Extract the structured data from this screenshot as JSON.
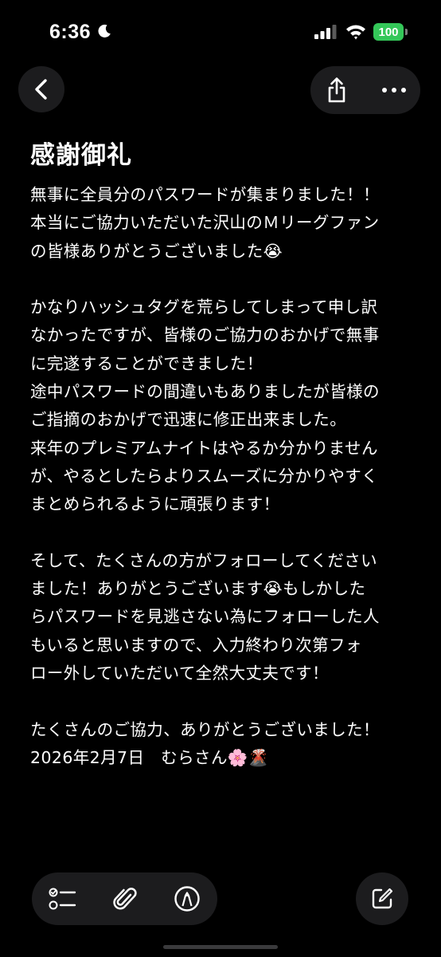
{
  "status_bar": {
    "time": "6:36",
    "battery": "100",
    "icons": [
      "moon-icon",
      "signal-icon",
      "wifi-icon",
      "battery-icon"
    ]
  },
  "nav": {
    "icons": [
      "chevron-left-icon",
      "share-icon",
      "ellipsis-icon"
    ]
  },
  "note": {
    "title": "感謝御礼",
    "lines": [
      "無事に全員分のパスワードが集まりました！！",
      "本当にご協力いただいた沢山のＭリーグファン",
      "の皆様ありがとうございました😭",
      "",
      "かなりハッシュタグを荒らしてしまって申し訳",
      "なかったですが、皆様のご協力のおかげで無事",
      "に完遂することができました！",
      "途中パスワードの間違いもありましたが皆様の",
      "ご指摘のおかげで迅速に修正出来ました。",
      "来年のプレミアムナイトはやるか分かりません",
      "が、やるとしたらよりスムーズに分かりやすく",
      "まとめられるように頑張ります！",
      "",
      "そして、たくさんの方がフォローしてください",
      "ました！ありがとうございます😭もしかした",
      "らパスワードを見逃さない為にフォローした人",
      "もいると思いますので、入力終わり次第フォ",
      "ロー外していただいて全然大丈夫です！",
      "",
      "たくさんのご協力、ありがとうございました！",
      "2026年2月7日　むらさん🌸🌋"
    ]
  },
  "toolbar": {
    "icons": [
      "checklist-icon",
      "paperclip-icon",
      "markup-pen-icon",
      "compose-icon"
    ]
  },
  "colors": {
    "background": "#000000",
    "button_bg": "#1c1c1e",
    "battery": "#34c759",
    "text": "#ffffff"
  }
}
